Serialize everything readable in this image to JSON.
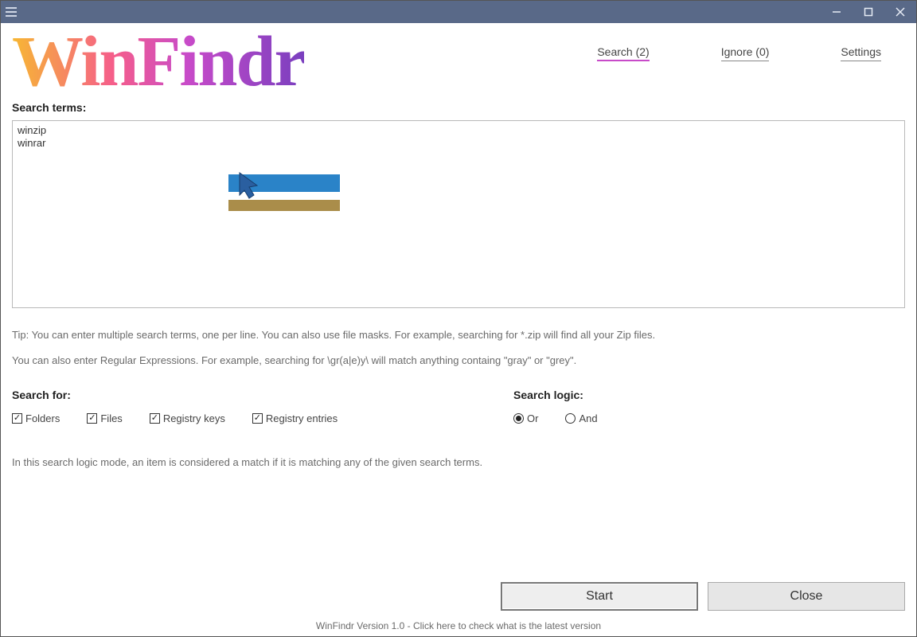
{
  "app_name": "WinFindr",
  "nav": {
    "search": "Search (2)",
    "ignore": "Ignore (0)",
    "settings": "Settings"
  },
  "labels": {
    "search_terms": "Search terms:",
    "search_for": "Search for:",
    "search_logic": "Search logic:"
  },
  "search_terms_value": "winzip\nwinrar",
  "tip_line1": "Tip: You can enter multiple search terms, one per line. You can also use file masks. For example, searching for *.zip will find all your Zip files.",
  "tip_line2": "You can also enter Regular Expressions. For example, searching for \\gr(a|e)y\\ will match anything containg \"gray\" or \"grey\".",
  "search_for": {
    "folders": "Folders",
    "files": "Files",
    "registry_keys": "Registry keys",
    "registry_entries": "Registry entries"
  },
  "search_logic": {
    "or": "Or",
    "and": "And"
  },
  "logic_description": "In this search logic mode, an item is considered a match if it is matching any of the given search terms.",
  "buttons": {
    "start": "Start",
    "close": "Close"
  },
  "footer": "WinFindr Version 1.0 - Click here to check what is the latest version"
}
